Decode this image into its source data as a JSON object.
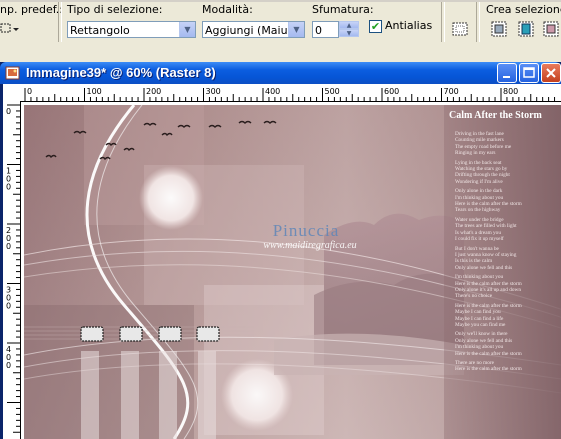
{
  "toolbar": {
    "preset_label": "np. predef.:",
    "selection_type_label": "Tipo di selezione:",
    "selection_type_value": "Rettangolo",
    "mode_label": "Modalità:",
    "mode_value": "Aggiungi (Maiusc)",
    "feather_label": "Sfumatura:",
    "feather_value": "0",
    "antialias_label": "Antialias",
    "antialias_checked": true,
    "create_selection_label": "Crea selezione da:"
  },
  "window": {
    "title": "Immagine39* @  60% (Raster 8)",
    "ruler_ticks": [
      "0",
      "100",
      "200",
      "300",
      "400",
      "500",
      "600",
      "700",
      "800"
    ],
    "vruler_ticks": [
      "0",
      "100",
      "200",
      "300",
      "400"
    ]
  },
  "artwork": {
    "watermark_line1": "Pinuccia",
    "watermark_line2": "www.maidiregrafica.eu",
    "poem_title": "Calm After the Storm",
    "poem_lines": [
      "Driving in the fast lane",
      "Counting mile markers",
      "The empty road before me",
      "Ringing in my ears",
      "Lying in the back seat",
      "Watching the stars go by",
      "Drifting through the night",
      "Wondering if I'm alive",
      "Only alone in the dark",
      "I'm thinking about you",
      "Here is the calm after the storm",
      "Tears on the highway",
      "Water under the bridge",
      "The trees are filled with light",
      "Is what's a dream you",
      "I could fix it up myself",
      "But I don't wanna be",
      "I just wanna know of staying",
      "Is this is the calm",
      "Only alone we fell and this",
      "I'm thinking about you",
      "Here is the calm after the storm",
      "Only alone it's all up and down",
      "There's no choice",
      "Here is the calm after the storm",
      "Maybe I can find you",
      "Maybe I can find a life",
      "Maybe you can find me",
      "Only we'll know in there",
      "Only alone we fell and this",
      "I'm thinking about you",
      "Here is the calm after the storm",
      "There are no more",
      "Here is the calm after the storm"
    ]
  },
  "colors": {
    "toolbar_bg": "#ece9d8",
    "title_bar": "#0655d6",
    "art_base": "#a8878a"
  }
}
